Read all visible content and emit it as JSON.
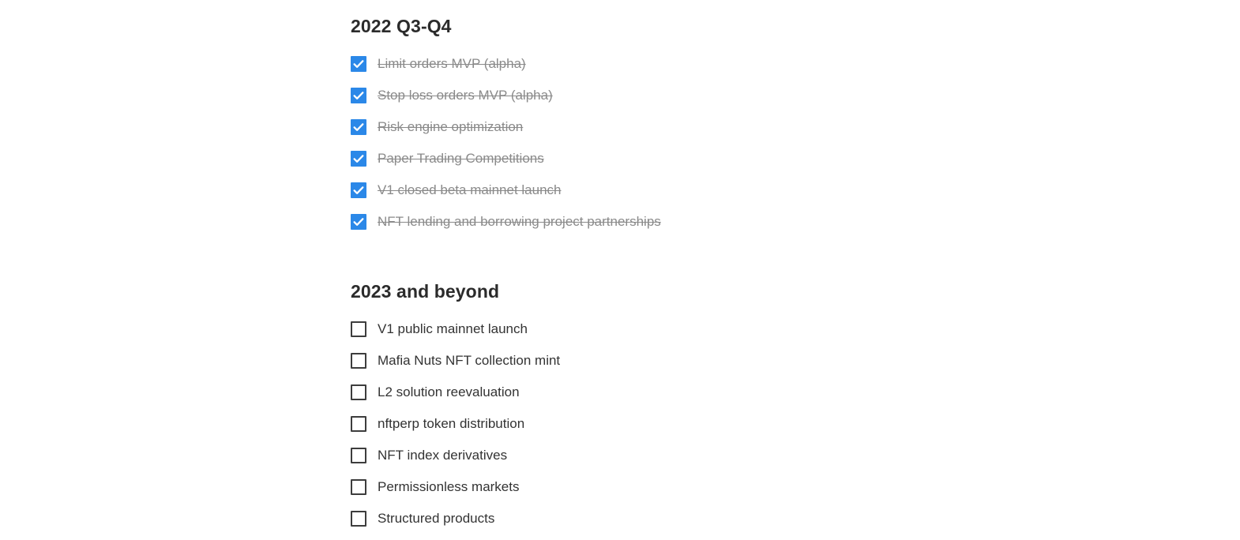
{
  "colors": {
    "background": "#ffffff",
    "checked_box": "#2b88e8",
    "checkmark": "#ffffff",
    "unchecked_border": "#3d3d3d",
    "heading_text": "#2b2b2b",
    "done_text": "#8a8a8a",
    "todo_text": "#333333"
  },
  "sections": [
    {
      "heading": "2022 Q3-Q4",
      "items": [
        {
          "label": "Limit orders MVP (alpha)",
          "checked": true
        },
        {
          "label": "Stop loss orders MVP (alpha)",
          "checked": true
        },
        {
          "label": "Risk engine optimization",
          "checked": true
        },
        {
          "label": "Paper Trading Competitions",
          "checked": true
        },
        {
          "label": "V1 closed beta mainnet launch",
          "checked": true
        },
        {
          "label": "NFT lending and borrowing project partnerships",
          "checked": true
        }
      ]
    },
    {
      "heading": "2023 and beyond",
      "items": [
        {
          "label": "V1 public mainnet launch",
          "checked": false
        },
        {
          "label": "Mafia Nuts NFT collection mint",
          "checked": false
        },
        {
          "label": "L2 solution reevaluation",
          "checked": false
        },
        {
          "label": "nftperp token distribution",
          "checked": false
        },
        {
          "label": "NFT index derivatives",
          "checked": false
        },
        {
          "label": "Permissionless markets",
          "checked": false
        },
        {
          "label": "Structured products",
          "checked": false
        }
      ]
    }
  ],
  "icons": {
    "checkmark": "check-icon",
    "empty_box": "empty-checkbox-icon"
  }
}
